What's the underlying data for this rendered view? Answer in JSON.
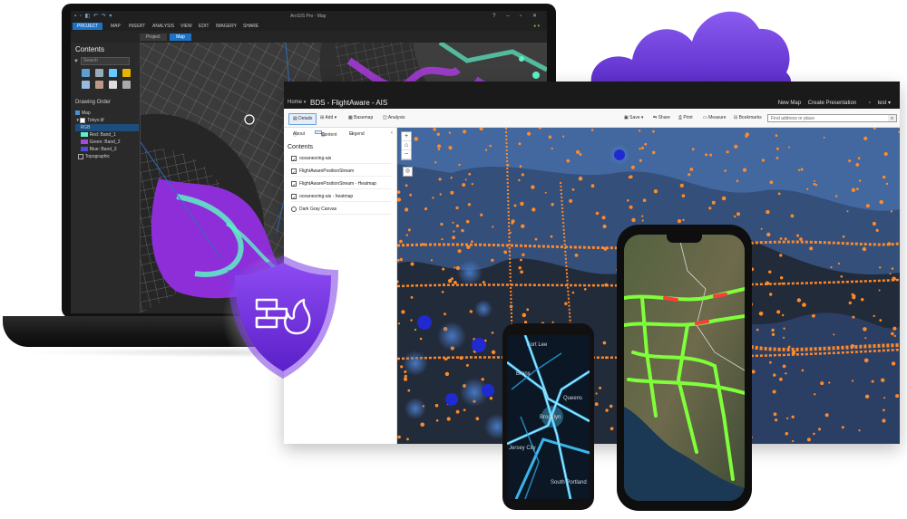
{
  "arcgis_pro": {
    "window_title": "ArcGIS Pro - Map",
    "ribbon_tabs": [
      "PROJECT",
      "MAP",
      "INSERT",
      "ANALYSIS",
      "VIEW",
      "EDIT",
      "IMAGERY",
      "SHARE"
    ],
    "user": "",
    "view_tabs": [
      "Project",
      "Map"
    ],
    "panel_title": "Contents",
    "search_placeholder": "Search",
    "drawing_order_label": "Drawing Order",
    "tree": {
      "map": "Map",
      "layer": "Tokyo.tif",
      "rgb": "RGB",
      "bands": [
        {
          "label": "Red:  Band_1",
          "color": "#5ef0c8"
        },
        {
          "label": "Green: Band_2",
          "color": "#a34be0"
        },
        {
          "label": "Blue:  Band_3",
          "color": "#4b4bd6"
        }
      ],
      "topographic": "Topographic"
    }
  },
  "browser": {
    "home": "Home",
    "title": "BDS - FlightAware - AIS",
    "right_links": [
      "New Map",
      "Create Presentation"
    ],
    "user": "test",
    "toolbar_left": [
      "Details",
      "Add",
      "Basemap",
      "Analysis"
    ],
    "toolbar_right": [
      "Save",
      "Share",
      "Print",
      "Measure",
      "Bookmarks"
    ],
    "search_placeholder": "Find address or place",
    "side_tabs": [
      "About",
      "Content",
      "Legend"
    ],
    "contents_heading": "Contents",
    "layers": [
      {
        "label": "oceanesring-ais",
        "checked": true
      },
      {
        "label": "FlightAwarePositionStream",
        "checked": true
      },
      {
        "label": "FlightAwarePositionStream - Heatmap",
        "checked": true
      },
      {
        "label": "oceanesring-ais - heatmap",
        "checked": true
      },
      {
        "label": "Dark Gray Canvas",
        "checked": false
      }
    ]
  },
  "phone_small": {
    "labels": [
      "Fort Lee",
      "Bronx",
      "Queens",
      "Brooklyn",
      "Jersey City",
      "South Portland"
    ]
  },
  "colors": {
    "cloud": "#7b4be0",
    "shield": "#7d3be6",
    "flight_orange": "#ff8a2a",
    "accent_blue": "#1c73c6",
    "traffic_green": "#7fff3a"
  }
}
